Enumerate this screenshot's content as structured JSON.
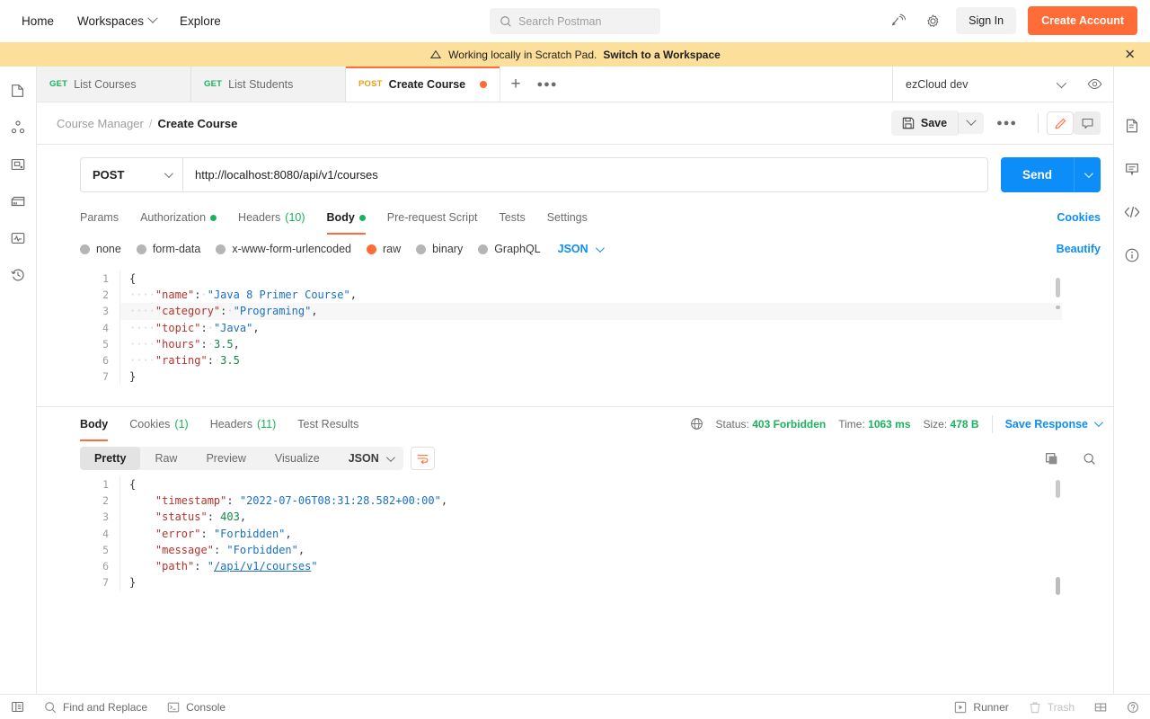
{
  "topnav": {
    "items": [
      {
        "label": "Home",
        "caret": false
      },
      {
        "label": "Workspaces",
        "caret": true
      },
      {
        "label": "Explore",
        "caret": false
      }
    ],
    "search_placeholder": "Search Postman",
    "sign_in": "Sign In",
    "create_account": "Create Account",
    "accent": "#ff6c37"
  },
  "banner": {
    "text": "Working locally in Scratch Pad.",
    "link": "Switch to a Workspace",
    "close": "✕",
    "bg": "#fbdf9a"
  },
  "sidebar_left": {
    "icons": [
      "collections-icon",
      "apis-icon",
      "environments-icon",
      "mock-servers-icon",
      "monitors-icon",
      "history-icon"
    ]
  },
  "sidebar_right": {
    "icons": [
      "documentation-icon",
      "comments-icon",
      "code-snippet-icon",
      "info-icon"
    ]
  },
  "tabs": {
    "items": [
      {
        "method": "GET",
        "label": "List Courses",
        "active": false,
        "unsaved": false
      },
      {
        "method": "GET",
        "label": "List Students",
        "active": false,
        "unsaved": false
      },
      {
        "method": "POST",
        "label": "Create Course",
        "active": true,
        "unsaved": true
      }
    ],
    "new_tab": "+",
    "more": "●●●",
    "environment": "ezCloud dev"
  },
  "header": {
    "breadcrumb_parent": "Course Manager",
    "breadcrumb_sep": "/",
    "breadcrumb_current": "Create Course",
    "save_label": "Save",
    "more": "●●●"
  },
  "request": {
    "method": "POST",
    "url": "http://localhost:8080/api/v1/courses",
    "send_label": "Send",
    "tabs": [
      {
        "label": "Params",
        "dot": false,
        "count": "",
        "active": false
      },
      {
        "label": "Authorization",
        "dot": true,
        "count": "",
        "active": false
      },
      {
        "label": "Headers",
        "dot": false,
        "count": "(10)",
        "active": false
      },
      {
        "label": "Body",
        "dot": true,
        "count": "",
        "active": true
      },
      {
        "label": "Pre-request Script",
        "dot": false,
        "count": "",
        "active": false
      },
      {
        "label": "Tests",
        "dot": false,
        "count": "",
        "active": false
      },
      {
        "label": "Settings",
        "dot": false,
        "count": "",
        "active": false
      }
    ],
    "cookies_link": "Cookies",
    "body_types": [
      {
        "label": "none",
        "selected": false
      },
      {
        "label": "form-data",
        "selected": false
      },
      {
        "label": "x-www-form-urlencoded",
        "selected": false
      },
      {
        "label": "raw",
        "selected": true
      },
      {
        "label": "binary",
        "selected": false
      },
      {
        "label": "GraphQL",
        "selected": false
      }
    ],
    "raw_format": "JSON",
    "beautify_label": "Beautify",
    "body_lines": [
      {
        "n": "1",
        "tokens": [
          {
            "t": "{",
            "c": "p"
          }
        ]
      },
      {
        "n": "2",
        "tokens": [
          {
            "t": "····",
            "c": "dotsp"
          },
          {
            "t": "\"name\"",
            "c": "k"
          },
          {
            "t": ":",
            "c": "p"
          },
          {
            "t": "·",
            "c": "dotsp"
          },
          {
            "t": "\"Java 8 Primer Course\"",
            "c": "s"
          },
          {
            "t": ",",
            "c": "p"
          }
        ]
      },
      {
        "n": "3",
        "highlight": true,
        "tokens": [
          {
            "t": "····",
            "c": "dotsp"
          },
          {
            "t": "\"category\"",
            "c": "k"
          },
          {
            "t": ":",
            "c": "p"
          },
          {
            "t": "·",
            "c": "dotsp"
          },
          {
            "t": "\"Programing\"",
            "c": "s"
          },
          {
            "t": ",",
            "c": "p"
          }
        ]
      },
      {
        "n": "4",
        "tokens": [
          {
            "t": "····",
            "c": "dotsp"
          },
          {
            "t": "\"topic\"",
            "c": "k"
          },
          {
            "t": ":",
            "c": "p"
          },
          {
            "t": "·",
            "c": "dotsp"
          },
          {
            "t": "\"Java\"",
            "c": "s"
          },
          {
            "t": ",",
            "c": "p"
          }
        ]
      },
      {
        "n": "5",
        "tokens": [
          {
            "t": "····",
            "c": "dotsp"
          },
          {
            "t": "\"hours\"",
            "c": "k"
          },
          {
            "t": ":",
            "c": "p"
          },
          {
            "t": "·",
            "c": "dotsp"
          },
          {
            "t": "3.5",
            "c": "n"
          },
          {
            "t": ",",
            "c": "p"
          }
        ]
      },
      {
        "n": "6",
        "tokens": [
          {
            "t": "····",
            "c": "dotsp"
          },
          {
            "t": "\"rating\"",
            "c": "k"
          },
          {
            "t": ":",
            "c": "p"
          },
          {
            "t": "·",
            "c": "dotsp"
          },
          {
            "t": "3.5",
            "c": "n"
          }
        ]
      },
      {
        "n": "7",
        "tokens": [
          {
            "t": "}",
            "c": "p"
          }
        ]
      }
    ]
  },
  "response": {
    "tabs": [
      {
        "label": "Body",
        "count": "",
        "active": true
      },
      {
        "label": "Cookies",
        "count": "(1)",
        "active": false
      },
      {
        "label": "Headers",
        "count": "(11)",
        "active": false
      },
      {
        "label": "Test Results",
        "count": "",
        "active": false
      }
    ],
    "status_label": "Status:",
    "status_value": "403 Forbidden",
    "time_label": "Time:",
    "time_value": "1063 ms",
    "size_label": "Size:",
    "size_value": "478 B",
    "save_response": "Save Response",
    "view_modes": [
      {
        "label": "Pretty",
        "active": true
      },
      {
        "label": "Raw",
        "active": false
      },
      {
        "label": "Preview",
        "active": false
      },
      {
        "label": "Visualize",
        "active": false
      }
    ],
    "format": "JSON",
    "body_lines": [
      {
        "n": "1",
        "tokens": [
          {
            "t": "{",
            "c": "p"
          }
        ]
      },
      {
        "n": "2",
        "tokens": [
          {
            "t": "    ",
            "c": "p"
          },
          {
            "t": "\"timestamp\"",
            "c": "k"
          },
          {
            "t": ": ",
            "c": "p"
          },
          {
            "t": "\"2022-07-06T08:31:28.582+00:00\"",
            "c": "s"
          },
          {
            "t": ",",
            "c": "p"
          }
        ]
      },
      {
        "n": "3",
        "tokens": [
          {
            "t": "    ",
            "c": "p"
          },
          {
            "t": "\"status\"",
            "c": "k"
          },
          {
            "t": ": ",
            "c": "p"
          },
          {
            "t": "403",
            "c": "n"
          },
          {
            "t": ",",
            "c": "p"
          }
        ]
      },
      {
        "n": "4",
        "tokens": [
          {
            "t": "    ",
            "c": "p"
          },
          {
            "t": "\"error\"",
            "c": "k"
          },
          {
            "t": ": ",
            "c": "p"
          },
          {
            "t": "\"Forbidden\"",
            "c": "s"
          },
          {
            "t": ",",
            "c": "p"
          }
        ]
      },
      {
        "n": "5",
        "tokens": [
          {
            "t": "    ",
            "c": "p"
          },
          {
            "t": "\"message\"",
            "c": "k"
          },
          {
            "t": ": ",
            "c": "p"
          },
          {
            "t": "\"Forbidden\"",
            "c": "s"
          },
          {
            "t": ",",
            "c": "p"
          }
        ]
      },
      {
        "n": "6",
        "tokens": [
          {
            "t": "    ",
            "c": "p"
          },
          {
            "t": "\"path\"",
            "c": "k"
          },
          {
            "t": ": ",
            "c": "p"
          },
          {
            "t": "\"",
            "c": "s"
          },
          {
            "t": "/api/v1/courses",
            "c": "s ul"
          },
          {
            "t": "\"",
            "c": "s"
          }
        ]
      },
      {
        "n": "7",
        "tokens": [
          {
            "t": "}",
            "c": "p"
          }
        ]
      }
    ]
  },
  "statusbar": {
    "left": [
      {
        "label": "",
        "icon": "sidebar-toggle-icon"
      },
      {
        "label": "Find and Replace",
        "icon": "search-icon"
      },
      {
        "label": "Console",
        "icon": "console-icon"
      }
    ],
    "right": [
      {
        "label": "Runner",
        "icon": "runner-icon",
        "dim": false
      },
      {
        "label": "Trash",
        "icon": "trash-icon",
        "dim": true
      },
      {
        "label": "",
        "icon": "layout-icon",
        "dim": false
      },
      {
        "label": "",
        "icon": "help-icon",
        "dim": false
      }
    ]
  }
}
